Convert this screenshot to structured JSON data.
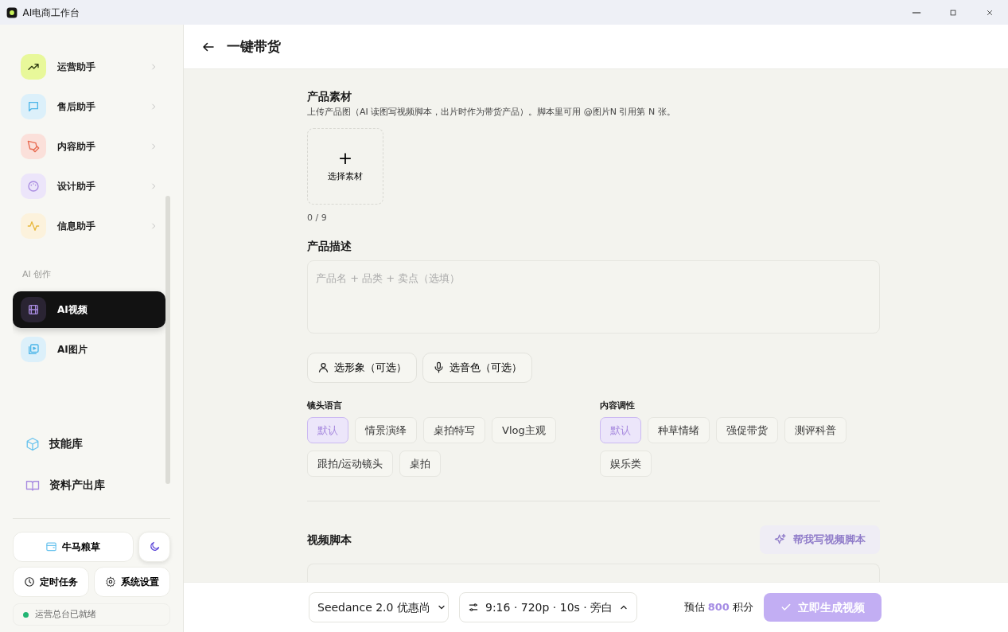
{
  "window": {
    "title": "AI电商工作台"
  },
  "sidebar": {
    "assistants": [
      {
        "label": "运营助手",
        "selected": false
      },
      {
        "label": "售后助手",
        "selected": false
      },
      {
        "label": "内容助手",
        "selected": false
      },
      {
        "label": "设计助手",
        "selected": false
      },
      {
        "label": "信息助手",
        "selected": false
      }
    ],
    "section_label": "AI 创作",
    "creation_items": [
      {
        "label": "AI视频",
        "selected": true
      },
      {
        "label": "AI图片",
        "selected": false
      }
    ],
    "libraries": [
      {
        "label": "技能库"
      },
      {
        "label": "资料产出库"
      }
    ],
    "supply_button": "牛马粮草",
    "schedule_button": "定时任务",
    "settings_button": "系统设置",
    "status": {
      "text": "运营总台已就绪",
      "color": "#22b573"
    }
  },
  "header": {
    "title": "一键带货"
  },
  "material": {
    "title": "产品素材",
    "description": "上传产品图（AI 读图写视频脚本，出片时作为带货产品）。脚本里可用 @图片N 引用第 N 张。",
    "upload_icon": "+",
    "upload_label": "选择素材",
    "count": "0 / 9"
  },
  "description": {
    "title": "产品描述",
    "placeholder": "产品名 + 品类 + 卖点（选填）"
  },
  "pickers": [
    "选形象（可选）",
    "选音色（可选）"
  ],
  "camera": {
    "title": "镜头语言",
    "options": [
      {
        "label": "默认",
        "selected": true
      },
      {
        "label": "情景演绎",
        "selected": false
      },
      {
        "label": "桌拍特写",
        "selected": false
      },
      {
        "label": "Vlog主观",
        "selected": false
      },
      {
        "label": "跟拍/运动镜头",
        "selected": false
      },
      {
        "label": "桌拍",
        "selected": false
      }
    ]
  },
  "tone": {
    "title": "内容调性",
    "options": [
      {
        "label": "默认",
        "selected": true
      },
      {
        "label": "种草情绪",
        "selected": false
      },
      {
        "label": "强促带货",
        "selected": false
      },
      {
        "label": "测评科普",
        "selected": false
      },
      {
        "label": "娱乐类",
        "selected": false
      }
    ]
  },
  "script": {
    "title": "视频脚本",
    "write_button": {
      "label": "帮我写视频脚本",
      "disabled": true
    }
  },
  "footer": {
    "model": "Seedance 2.0 优惠尚",
    "settings": "9:16 · 720p · 10s · 旁白",
    "estimate_prefix": "预估",
    "estimate_value": "800",
    "estimate_suffix": "积分",
    "generate_button": {
      "label": "立即生成视频",
      "disabled": true
    }
  }
}
